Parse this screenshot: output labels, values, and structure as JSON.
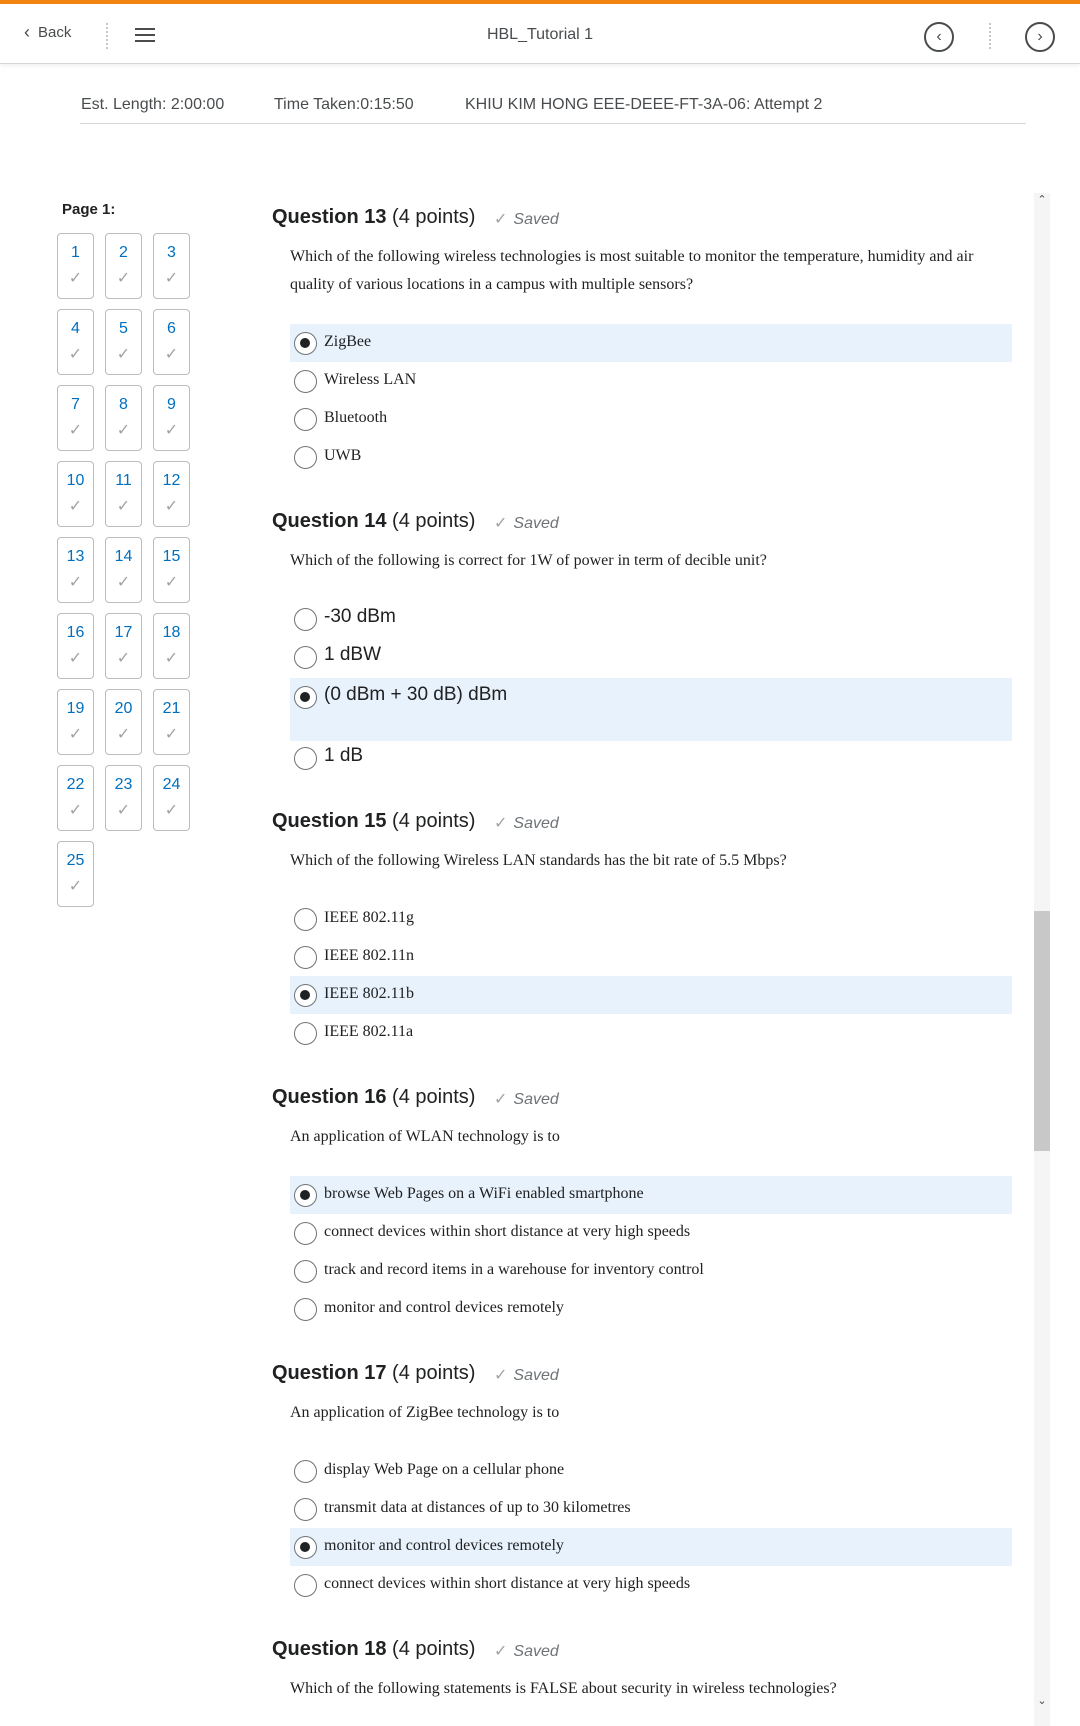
{
  "header": {
    "back_label": "Back",
    "title": "HBL_Tutorial 1"
  },
  "info": {
    "est_length": "Est. Length: 2:00:00",
    "time_taken": "Time Taken:0:15:50",
    "attempt": "KHIU KIM HONG EEE-DEEE-FT-3A-06: Attempt 2"
  },
  "navigator": {
    "page_label": "Page 1:",
    "questions": [
      "1",
      "2",
      "3",
      "4",
      "5",
      "6",
      "7",
      "8",
      "9",
      "10",
      "11",
      "12",
      "13",
      "14",
      "15",
      "16",
      "17",
      "18",
      "19",
      "20",
      "21",
      "22",
      "23",
      "24",
      "25"
    ],
    "check_glyph": "✓"
  },
  "questions": [
    {
      "title": "Question 13",
      "points": "(4 points)",
      "status": "Saved",
      "text": "Which of the following wireless technologies is most suitable to monitor the temperature, humidity and air quality of various locations in a campus with multiple sensors?",
      "options": [
        "ZigBee",
        "Wireless LAN",
        "Bluetooth",
        "UWB"
      ],
      "selected": 0
    },
    {
      "title": "Question 14",
      "points": "(4 points)",
      "status": "Saved",
      "text": "Which of the following is correct for 1W of power in term of decible unit?",
      "options": [
        "-30 dBm",
        "1 dBW",
        "(0 dBm + 30 dB) dBm",
        "1 dB"
      ],
      "selected": 2
    },
    {
      "title": "Question 15",
      "points": "(4 points)",
      "status": "Saved",
      "text": "Which of the following Wireless LAN standards has the bit rate of 5.5 Mbps?",
      "options": [
        "IEEE 802.11g",
        "IEEE 802.11n",
        "IEEE 802.11b",
        "IEEE 802.11a"
      ],
      "selected": 2
    },
    {
      "title": "Question 16",
      "points": "(4 points)",
      "status": "Saved",
      "text": "An application of WLAN technology is to",
      "options": [
        "browse Web Pages on a WiFi enabled smartphone",
        "connect devices within short distance at very high speeds",
        "track and record items in a warehouse for inventory control",
        "monitor and control devices remotely"
      ],
      "selected": 0
    },
    {
      "title": "Question 17",
      "points": "(4 points)",
      "status": "Saved",
      "text": "An application of ZigBee technology is to",
      "options": [
        "display Web Page on a cellular phone",
        "transmit data at distances of up to 30 kilometres",
        "monitor and control devices remotely",
        "connect devices within short distance at very high speeds"
      ],
      "selected": 2
    },
    {
      "title": "Question 18",
      "points": "(4 points)",
      "status": "Saved",
      "text": "Which of the following statements is FALSE about security in wireless technologies?",
      "options": [],
      "selected": -1
    }
  ],
  "colors": {
    "accent_bar": "#f2840f",
    "link_blue": "#006fbf",
    "selected_bg": "#e8f2fc"
  }
}
